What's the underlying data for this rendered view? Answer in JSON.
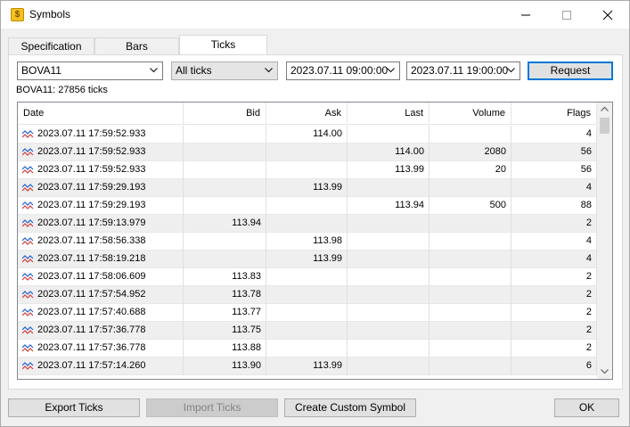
{
  "window": {
    "title": "Symbols"
  },
  "tabs": [
    "Specification",
    "Bars",
    "Ticks"
  ],
  "filters": {
    "symbol": "BOVA11",
    "mode": "All ticks",
    "from": "2023.07.11 09:00:00",
    "to": "2023.07.11 19:00:00",
    "request_label": "Request"
  },
  "summary": "BOVA11: 27856 ticks",
  "table": {
    "columns": [
      "Date",
      "Bid",
      "Ask",
      "Last",
      "Volume",
      "Flags"
    ],
    "rows": [
      [
        "2023.07.11 17:59:52.933",
        "",
        "114.00",
        "",
        "",
        "4"
      ],
      [
        "2023.07.11 17:59:52.933",
        "",
        "",
        "114.00",
        "2080",
        "56"
      ],
      [
        "2023.07.11 17:59:52.933",
        "",
        "",
        "113.99",
        "20",
        "56"
      ],
      [
        "2023.07.11 17:59:29.193",
        "",
        "113.99",
        "",
        "",
        "4"
      ],
      [
        "2023.07.11 17:59:29.193",
        "",
        "",
        "113.94",
        "500",
        "88"
      ],
      [
        "2023.07.11 17:59:13.979",
        "113.94",
        "",
        "",
        "",
        "2"
      ],
      [
        "2023.07.11 17:58:56.338",
        "",
        "113.98",
        "",
        "",
        "4"
      ],
      [
        "2023.07.11 17:58:19.218",
        "",
        "113.99",
        "",
        "",
        "4"
      ],
      [
        "2023.07.11 17:58:06.609",
        "113.83",
        "",
        "",
        "",
        "2"
      ],
      [
        "2023.07.11 17:57:54.952",
        "113.78",
        "",
        "",
        "",
        "2"
      ],
      [
        "2023.07.11 17:57:40.688",
        "113.77",
        "",
        "",
        "",
        "2"
      ],
      [
        "2023.07.11 17:57:36.778",
        "113.75",
        "",
        "",
        "",
        "2"
      ],
      [
        "2023.07.11 17:57:36.778",
        "113.88",
        "",
        "",
        "",
        "2"
      ],
      [
        "2023.07.11 17:57:14.260",
        "113.90",
        "113.99",
        "",
        "",
        "6"
      ]
    ]
  },
  "footer": {
    "export_label": "Export Ticks",
    "import_label": "Import Ticks",
    "custom_label": "Create Custom Symbol",
    "ok_label": "OK"
  },
  "colors": {
    "accent": "#0078d7",
    "tick_blue": "#1f5fd6",
    "tick_red": "#d93a3a"
  }
}
